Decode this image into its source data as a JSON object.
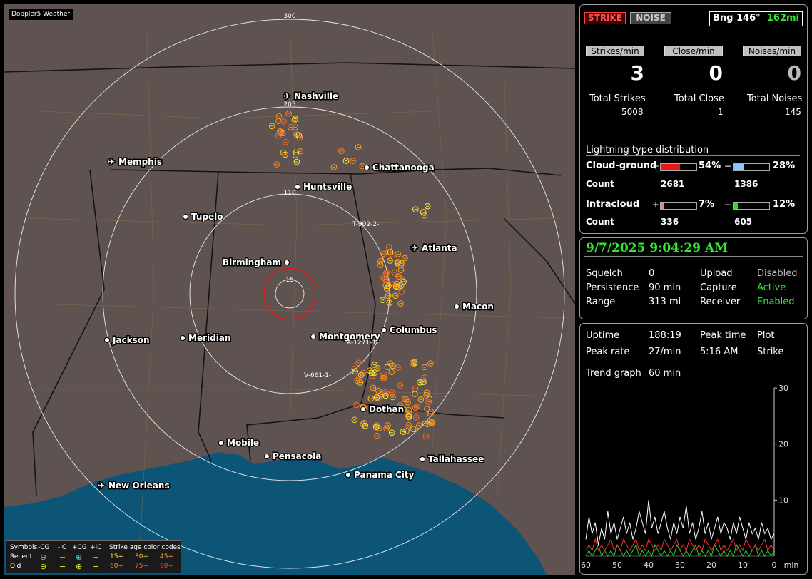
{
  "app_title": "Doppler5 Weather",
  "map": {
    "range_labels": [
      "300",
      "205",
      "110",
      "15"
    ],
    "cities": [
      {
        "name": "Nashville",
        "icon": "airport"
      },
      {
        "name": "Memphis",
        "icon": "airport"
      },
      {
        "name": "Chattanooga",
        "icon": "dot"
      },
      {
        "name": "Huntsville",
        "icon": "dot"
      },
      {
        "name": "Tupelo",
        "icon": "dot"
      },
      {
        "name": "Atlanta",
        "icon": "airport"
      },
      {
        "name": "Birmingham",
        "icon": "dot"
      },
      {
        "name": "Macon",
        "icon": "dot"
      },
      {
        "name": "Jackson",
        "icon": "dot"
      },
      {
        "name": "Meridian",
        "icon": "dot"
      },
      {
        "name": "Montgomery",
        "icon": "dot"
      },
      {
        "name": "Columbus",
        "icon": "dot"
      },
      {
        "name": "Dothan",
        "icon": "dot"
      },
      {
        "name": "Mobile",
        "icon": "dot"
      },
      {
        "name": "Pensacola",
        "icon": "dot"
      },
      {
        "name": "Tallahassee",
        "icon": "dot"
      },
      {
        "name": "Panama City",
        "icon": "dot"
      },
      {
        "name": "New Orleans",
        "icon": "airport"
      }
    ],
    "annotations": [
      "T-902-2",
      "A-1271-1",
      "V-661-1"
    ]
  },
  "legend": {
    "header": [
      "Symbols",
      "-CG",
      "-IC",
      "+CG",
      "+IC",
      "Strike age color codes"
    ],
    "recent_label": "Recent",
    "old_label": "Old",
    "recent_codes": [
      "15+",
      "30+",
      "45+"
    ],
    "old_codes": [
      "60+",
      "75+",
      "90+"
    ]
  },
  "status": {
    "strike_btn": "STRIKE",
    "noise_btn": "NOISE",
    "bearing": "Bng 146°",
    "distance": "162mi",
    "rate_labels": [
      "Strikes/min",
      "Close/min",
      "Noises/min"
    ],
    "rates": [
      "3",
      "0",
      "0"
    ],
    "total_labels": [
      "Total Strikes",
      "Total Close",
      "Total Noises"
    ],
    "totals": [
      "5008",
      "1",
      "145"
    ],
    "dist_title": "Lightning type distribution",
    "cg_label": "Cloud-ground",
    "ic_label": "Intracloud",
    "count_label": "Count",
    "plus": "+",
    "minus": "−",
    "cg_pos_pct": "54%",
    "cg_neg_pct": "28%",
    "ic_pos_pct": "7%",
    "ic_neg_pct": "12%",
    "cg_pos_fill": 0.54,
    "cg_neg_fill": 0.28,
    "ic_pos_fill": 0.07,
    "ic_neg_fill": 0.12,
    "cg_pos_count": "2681",
    "cg_neg_count": "1386",
    "ic_pos_count": "336",
    "ic_neg_count": "605"
  },
  "settings": {
    "datetime": "9/7/2025 9:04:29 AM",
    "squelch_label": "Squelch",
    "squelch": "0",
    "persistence_label": "Persistence",
    "persistence": "90 min",
    "range_label": "Range",
    "range": "313 mi",
    "upload_label": "Upload",
    "upload": "Disabled",
    "capture_label": "Capture",
    "capture": "Active",
    "receiver_label": "Receiver",
    "receiver": "Enabled"
  },
  "trend": {
    "uptime_label": "Uptime",
    "uptime": "188:19",
    "peak_time_label": "Peak time",
    "peak_time": "5:16 AM",
    "plot_label": "Plot",
    "plot": "Strike",
    "peak_rate_label": "Peak rate",
    "peak_rate": "27/min",
    "trend_label": "Trend graph",
    "trend_value": "60 min",
    "y_ticks": [
      "30",
      "20",
      "10"
    ],
    "x_ticks": [
      "60",
      "50",
      "40",
      "30",
      "20",
      "10",
      "0"
    ],
    "x_unit": "min"
  },
  "chart_data": {
    "type": "line",
    "xlabel": "min",
    "ylim": [
      0,
      30
    ],
    "x": [
      60,
      59,
      58,
      57,
      56,
      55,
      54,
      53,
      52,
      51,
      50,
      49,
      48,
      47,
      46,
      45,
      44,
      43,
      42,
      41,
      40,
      39,
      38,
      37,
      36,
      35,
      34,
      33,
      32,
      31,
      30,
      29,
      28,
      27,
      26,
      25,
      24,
      23,
      22,
      21,
      20,
      19,
      18,
      17,
      16,
      15,
      14,
      13,
      12,
      11,
      10,
      9,
      8,
      7,
      6,
      5,
      4,
      3,
      2,
      1,
      0
    ],
    "series": [
      {
        "color": "#ffffff",
        "values": [
          3,
          7,
          4,
          6,
          2,
          5,
          3,
          8,
          4,
          6,
          3,
          5,
          7,
          4,
          6,
          3,
          5,
          8,
          6,
          4,
          10,
          5,
          7,
          4,
          6,
          8,
          5,
          3,
          6,
          4,
          7,
          5,
          9,
          4,
          6,
          3,
          5,
          8,
          4,
          6,
          3,
          5,
          7,
          4,
          6,
          5,
          3,
          6,
          4,
          7,
          5,
          3,
          6,
          4,
          5,
          3,
          6,
          4,
          5,
          3,
          4
        ]
      },
      {
        "color": "#ff3030",
        "values": [
          1,
          2,
          1,
          3,
          1,
          2,
          1,
          2,
          3,
          1,
          2,
          1,
          3,
          2,
          1,
          2,
          3,
          1,
          2,
          1,
          3,
          2,
          1,
          2,
          1,
          3,
          2,
          1,
          2,
          3,
          1,
          2,
          1,
          3,
          2,
          1,
          2,
          1,
          3,
          2,
          1,
          2,
          3,
          1,
          2,
          1,
          2,
          3,
          1,
          2,
          1,
          3,
          2,
          1,
          2,
          1,
          2,
          3,
          1,
          2,
          1
        ]
      },
      {
        "color": "#30d030",
        "values": [
          0,
          1,
          0,
          1,
          2,
          0,
          1,
          0,
          1,
          0,
          2,
          1,
          0,
          1,
          0,
          1,
          2,
          0,
          1,
          0,
          1,
          0,
          2,
          1,
          0,
          1,
          0,
          1,
          0,
          2,
          1,
          0,
          1,
          0,
          1,
          2,
          0,
          1,
          0,
          1,
          0,
          2,
          1,
          0,
          1,
          0,
          1,
          0,
          2,
          1,
          0,
          1,
          0,
          1,
          2,
          0,
          1,
          0,
          1,
          0,
          1
        ]
      }
    ]
  }
}
